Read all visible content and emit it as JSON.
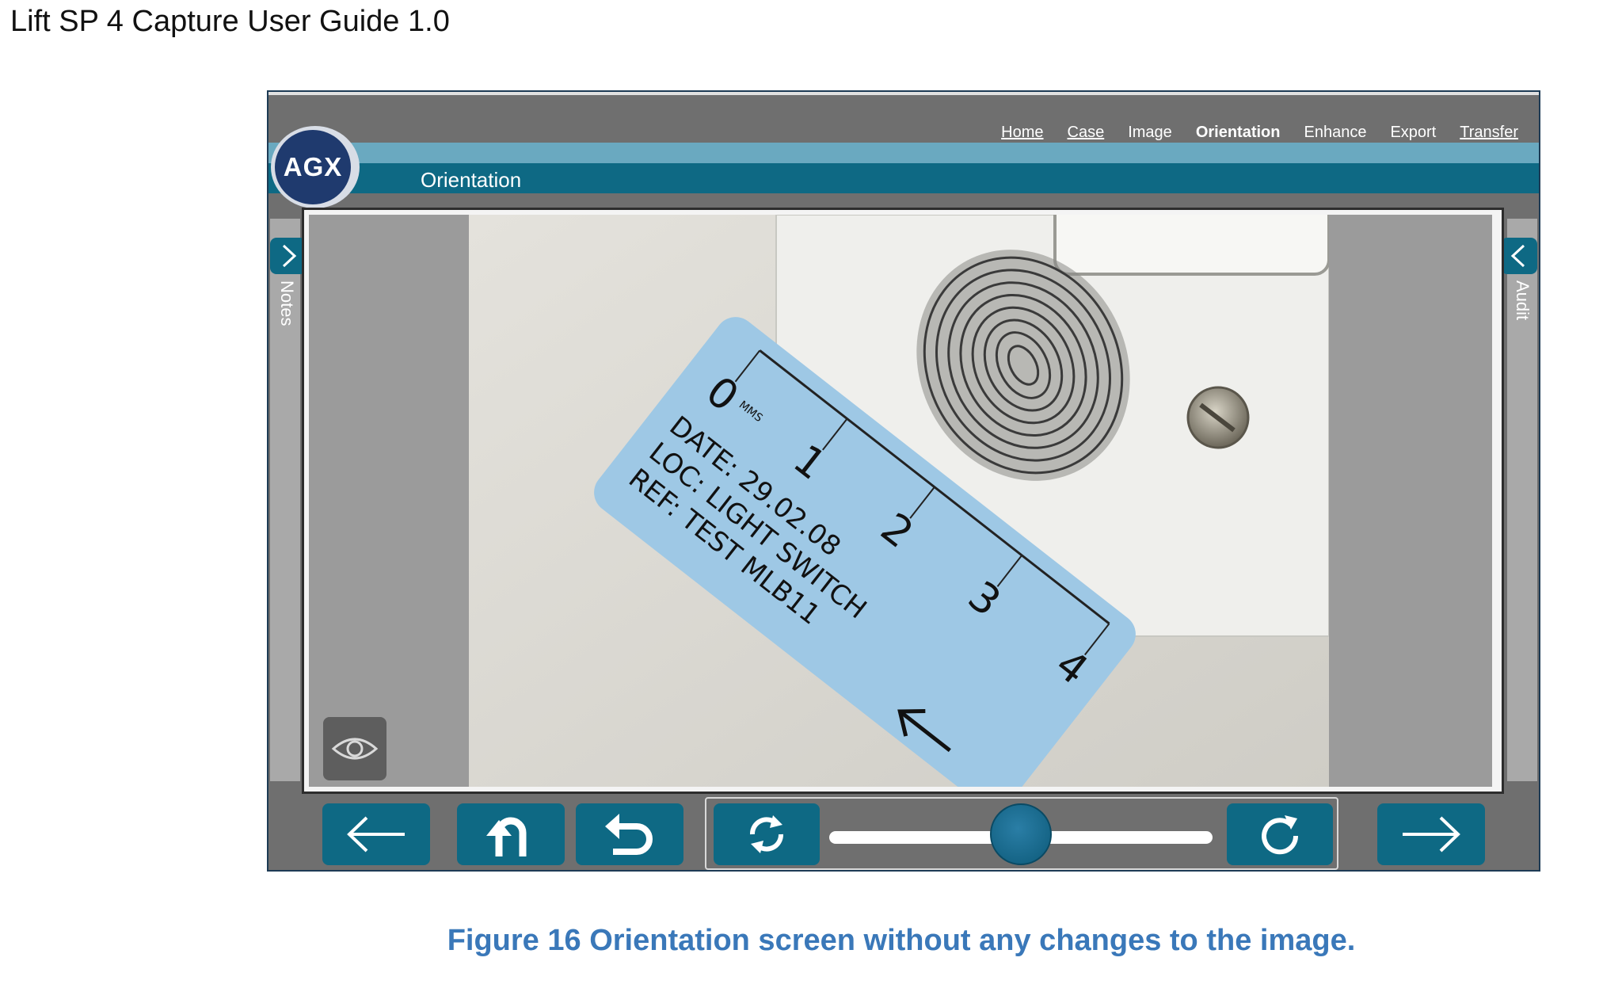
{
  "document": {
    "header": "Lift SP 4 Capture User Guide 1.0",
    "caption": "Figure 16 Orientation screen without any changes to the image."
  },
  "app": {
    "logo_text": "AGX",
    "screen_title": "Orientation",
    "nav": [
      {
        "label": "Home"
      },
      {
        "label": "Case"
      },
      {
        "label": "Image"
      },
      {
        "label": "Orientation"
      },
      {
        "label": "Enhance"
      },
      {
        "label": "Export"
      },
      {
        "label": "Transfer"
      }
    ],
    "left_panel_label": "Notes",
    "right_panel_label": "Audit",
    "rotation_slider": {
      "value_fraction": 0.5
    }
  },
  "photo_label": {
    "scale_numbers": [
      "0",
      "1",
      "2",
      "3",
      "4"
    ],
    "units": "MMS",
    "date_line": "DATE: 29.02.08",
    "loc_line": "LOC: LIGHT SWITCH",
    "ref_line": "REF: TEST MLB11"
  },
  "colors": {
    "accent": "#0e6984",
    "caption": "#3a78b9",
    "logo": "#1f3a6e"
  }
}
